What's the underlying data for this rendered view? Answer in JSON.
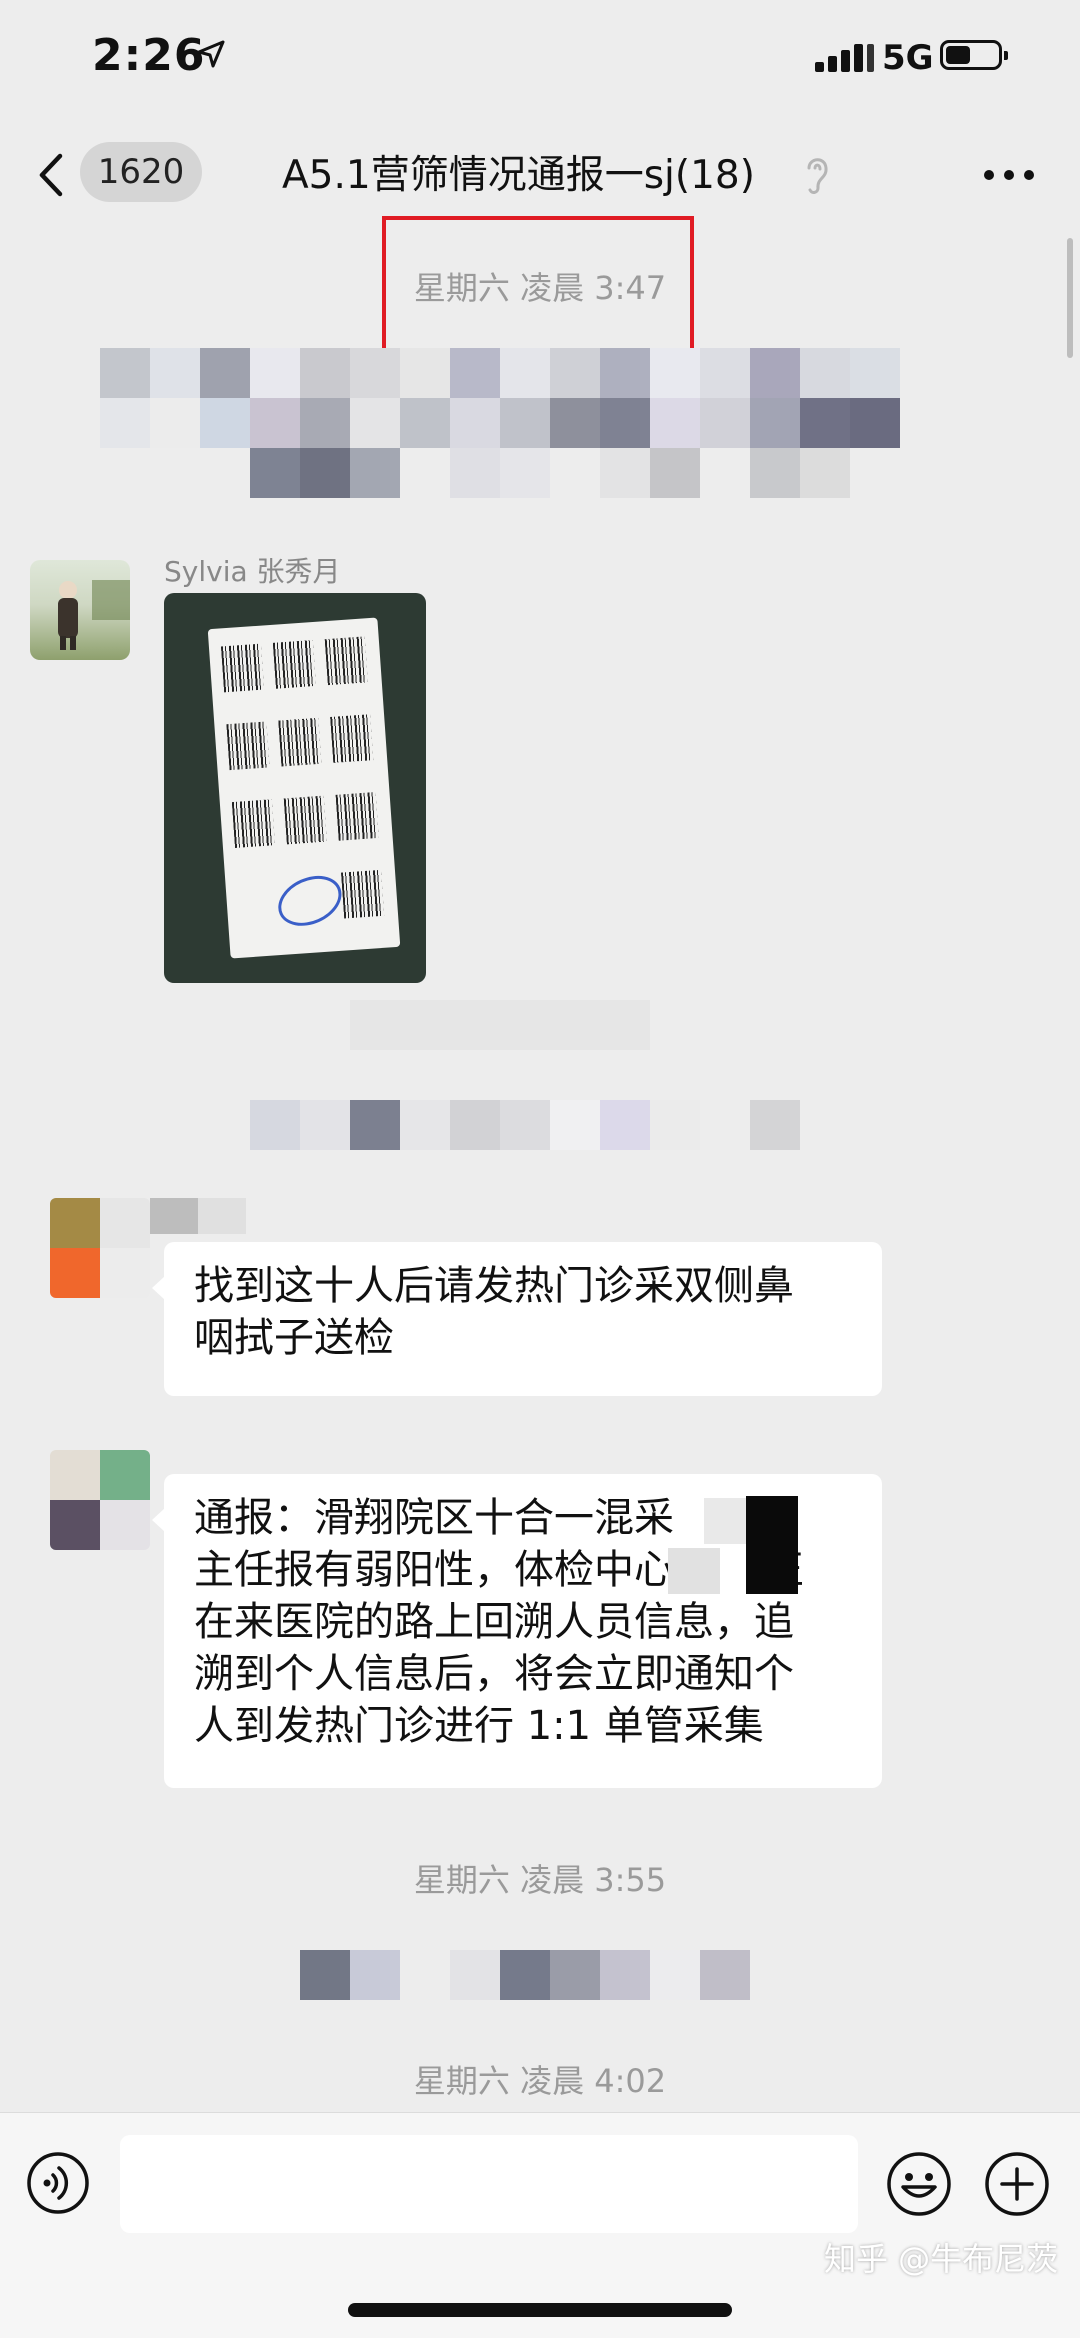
{
  "status_bar": {
    "time": "2:26",
    "network": "5G"
  },
  "header": {
    "unread_count": "1620",
    "title": "A5.1营筛情况通报一sj(18)"
  },
  "messages": {
    "time_1": "星期六 凌晨 3:47",
    "sender_1": "Sylvia 张秀月",
    "text_1_line1": "找到这十人后请发热门诊采双侧鼻",
    "text_1_line2": "咽拭子送检",
    "text_2_line1": "通报：滑翔院区十合一混采",
    "text_2_line2a": "主任报有弱阳性，体检中心",
    "text_2_line2b": "正",
    "text_2_line3": "在来医院的路上回溯人员信息，追",
    "text_2_line4": "溯到个人信息后，将会立即通知个",
    "text_2_line5": "人到发热门诊进行 1:1 单管采集",
    "time_2": "星期六 凌晨 3:55",
    "time_3": "星期六 凌晨 4:02"
  },
  "watermark": "知乎 @牛布尼茨",
  "icons": {
    "status": [
      "location-arrow-icon",
      "signal-icon",
      "battery-icon"
    ],
    "nav": [
      "back-chevron-icon",
      "mute-icon",
      "more-icon"
    ],
    "input": [
      "voice-icon",
      "emoji-icon",
      "plus-icon"
    ]
  },
  "colors": {
    "background": "#ededed",
    "highlight": "#e01b24",
    "bubble": "#ffffff",
    "timestamp": "#9a9a9a"
  }
}
